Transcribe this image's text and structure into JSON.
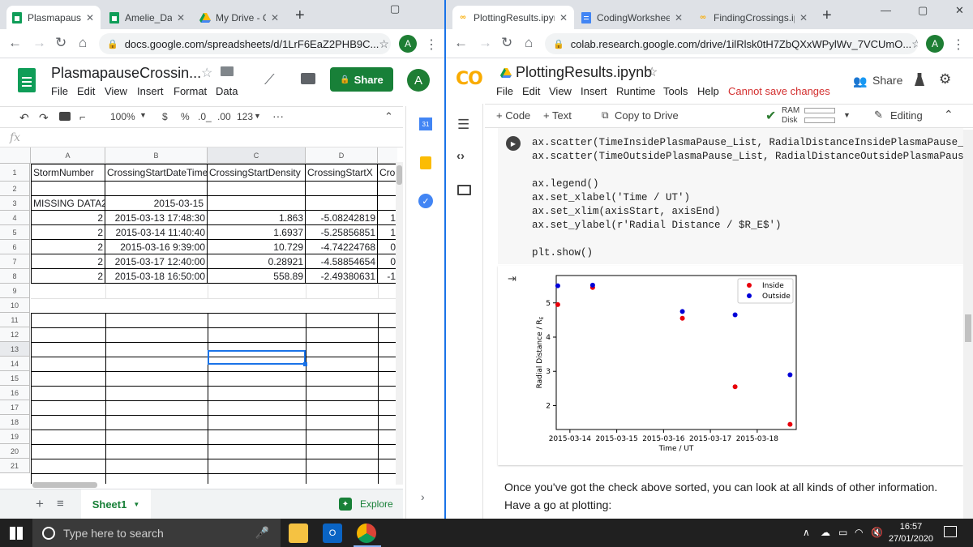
{
  "left_browser": {
    "tabs": [
      {
        "title": "PlasmapauseCrossings",
        "active": true
      },
      {
        "title": "Amelie_Data",
        "active": false
      },
      {
        "title": "My Drive - Google Drive",
        "active": false
      }
    ],
    "url": "docs.google.com/spreadsheets/d/1LrF6EaZ2PHB9C...",
    "avatar": "A"
  },
  "sheets": {
    "doc_title": "PlasmapauseCrossin...",
    "menu": [
      "File",
      "Edit",
      "View",
      "Insert",
      "Format",
      "Data"
    ],
    "share_label": "Share",
    "avatar": "A",
    "toolbar": {
      "zoom": "100%",
      "currency": "$",
      "percent": "%",
      "dec_less": ".0_",
      "dec_more": ".00",
      "format": "123"
    },
    "fx": "fx",
    "columns": [
      "A",
      "B",
      "C",
      "D"
    ],
    "row_numbers": [
      "1",
      "2",
      "3",
      "4",
      "5",
      "6",
      "7",
      "8",
      "9",
      "10",
      "11",
      "12",
      "13",
      "14",
      "15",
      "16",
      "17",
      "18",
      "19",
      "20",
      "21"
    ],
    "headers": [
      "StormNumber",
      "CrossingStartDateTime",
      "CrossingStartDensity",
      "CrossingStartX",
      "Cro"
    ],
    "rows": [
      [
        "",
        "",
        "",
        "",
        ""
      ],
      [
        "MISSING DATA2",
        "2015-03-15",
        "",
        "",
        ""
      ],
      [
        "2",
        "2015-03-13 17:48:30",
        "1.863",
        "-5.08242819",
        "1"
      ],
      [
        "2",
        "2015-03-14 11:40:40",
        "1.6937",
        "-5.25856851",
        "1"
      ],
      [
        "2",
        "2015-03-16 9:39:00",
        "10.729",
        "-4.74224768",
        "0"
      ],
      [
        "2",
        "2015-03-17 12:40:00",
        "0.28921",
        "-4.58854654",
        "0"
      ],
      [
        "2",
        "2015-03-18 16:50:00",
        "558.89",
        "-2.49380631",
        "-1"
      ]
    ],
    "sheet_tab": "Sheet1",
    "explore": "Explore"
  },
  "right_browser": {
    "tabs": [
      {
        "title": "PlottingResults.ipynb",
        "active": true
      },
      {
        "title": "CodingWorksheets",
        "active": false
      },
      {
        "title": "FindingCrossings.ipynb",
        "active": false
      }
    ],
    "url": "colab.research.google.com/drive/1ilRlsk0tH7ZbQXxWPylWv_7VCUmO...",
    "avatar": "A"
  },
  "colab": {
    "logo": "CO",
    "title": "PlottingResults.ipynb",
    "menu": [
      "File",
      "Edit",
      "View",
      "Insert",
      "Runtime",
      "Tools",
      "Help"
    ],
    "warning": "Cannot save changes",
    "share": "Share",
    "add_code": "+ Code",
    "add_text": "+ Text",
    "copy_drive": "Copy to Drive",
    "ram": "RAM",
    "disk": "Disk",
    "editing": "Editing",
    "code_lines": [
      "ax.scatter(TimeInsidePlasmaPause_List, RadialDistanceInsidePlasmaPause_List, co",
      "ax.scatter(TimeOutsidePlasmaPause_List, RadialDistanceOutsidePlasmaPause_List,",
      "",
      "ax.legend()",
      "ax.set_xlabel('Time / UT')",
      "ax.set_xlim(axisStart, axisEnd)",
      "ax.set_ylabel(r'Radial Distance / $R_E$')",
      "",
      "plt.show()"
    ],
    "markdown": "Once you've got the check above sorted, you can look at all kinds of other information. Have a go at plotting:"
  },
  "chart_data": {
    "type": "scatter",
    "xlabel": "Time / UT",
    "ylabel": "Radial Distance / R_E",
    "xticks": [
      "2015-03-14",
      "2015-03-15",
      "2015-03-16",
      "2015-03-17",
      "2015-03-18"
    ],
    "xlim": [
      "2015-03-13 17:00",
      "2015-03-18 20:00"
    ],
    "ylim": [
      1.3,
      5.8
    ],
    "yticks": [
      2,
      3,
      4,
      5
    ],
    "legend_position": "top-right",
    "series": [
      {
        "name": "Inside",
        "color": "#e8000b",
        "points": [
          [
            "2015-03-13 17:48",
            4.95
          ],
          [
            "2015-03-14 11:40",
            5.45
          ],
          [
            "2015-03-16 09:39",
            4.55
          ],
          [
            "2015-03-17 12:40",
            2.55
          ],
          [
            "2015-03-18 16:50",
            1.45
          ]
        ]
      },
      {
        "name": "Outside",
        "color": "#0000d8",
        "points": [
          [
            "2015-03-13 17:48",
            5.5
          ],
          [
            "2015-03-14 11:40",
            5.52
          ],
          [
            "2015-03-16 09:39",
            4.75
          ],
          [
            "2015-03-17 12:40",
            4.65
          ],
          [
            "2015-03-18 16:50",
            2.9
          ]
        ]
      }
    ]
  },
  "taskbar": {
    "search_placeholder": "Type here to search",
    "time": "16:57",
    "date": "27/01/2020"
  }
}
